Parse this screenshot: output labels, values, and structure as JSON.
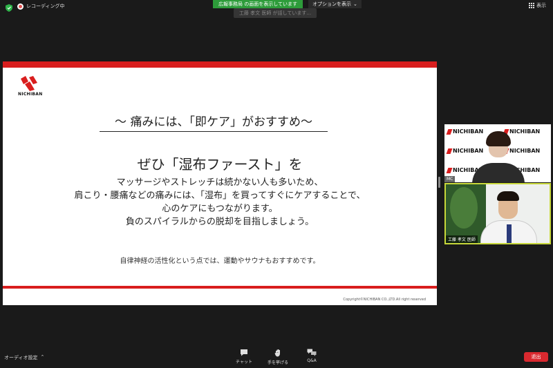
{
  "top_bar": {
    "recording_label": "レコーディング中",
    "share_banner": "広報事務局 の画面を表示しています",
    "options_label": "オプションを表示",
    "speaker_label": "工藤 孝文 医師 が話しています...",
    "view_label": "表示"
  },
  "slide": {
    "logo_text": "NICHIBAN",
    "headline": "～ 痛みには、「即ケア」がおすすめ～",
    "subhead": "ぜひ「湿布ファースト」を",
    "body_lines": [
      "マッサージやストレッチは続かない人も多いため、",
      "肩こり・腰痛などの痛みには、「湿布」を買ってすぐにケアすることで、",
      "心のケアにもつながります。",
      "負のスパイラルからの脱却を目指しましょう。"
    ],
    "note": "自律神経の活性化という点では、運動やサウナもおすすめです。",
    "copyright": "Copyright©NICHIBAN CO.,LTD.All right reserved",
    "accent_color": "#d91e1e"
  },
  "participants": {
    "mc_label": "MC",
    "brand_text": "NICHIBAN",
    "doctor_label": "工藤 孝文 医師"
  },
  "bottom_bar": {
    "audio_settings": "オーディオ設定",
    "chat": "チャット",
    "raise_hand": "手を挙げる",
    "qa": "Q&A",
    "leave": "退出"
  }
}
